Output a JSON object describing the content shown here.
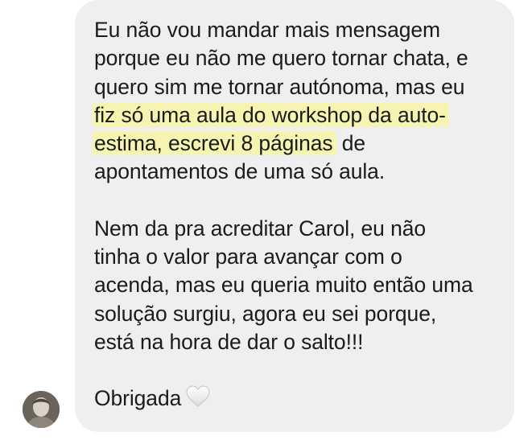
{
  "message": {
    "paragraph1": {
      "lines": [
        "Eu não vou mandar mais mensagem",
        "porque eu não me quero tornar chata, e",
        "quero sim me tornar autónoma, mas eu"
      ],
      "highlight_line1": "fiz só uma aula do workshop da auto-",
      "highlight_line2_part": "estima, escrevi 8 páginas",
      "line2_rest": " de",
      "last_line": "apontamentos de uma só aula."
    },
    "paragraph2": {
      "lines": [
        "Nem da pra acreditar Carol, eu não",
        "tinha o valor para avançar com o",
        "acenda, mas eu queria muito então uma",
        "solução surgiu, agora eu sei porque,",
        "está na hora de dar o salto!!!"
      ]
    },
    "closing": "Obrigada",
    "heart_icon": "white-heart-emoji",
    "colors": {
      "bubble": "#efeff1",
      "text": "#1b1b1b",
      "highlight": "#f6f4b0"
    }
  },
  "sender": {
    "avatar_icon": "profile-photo"
  }
}
